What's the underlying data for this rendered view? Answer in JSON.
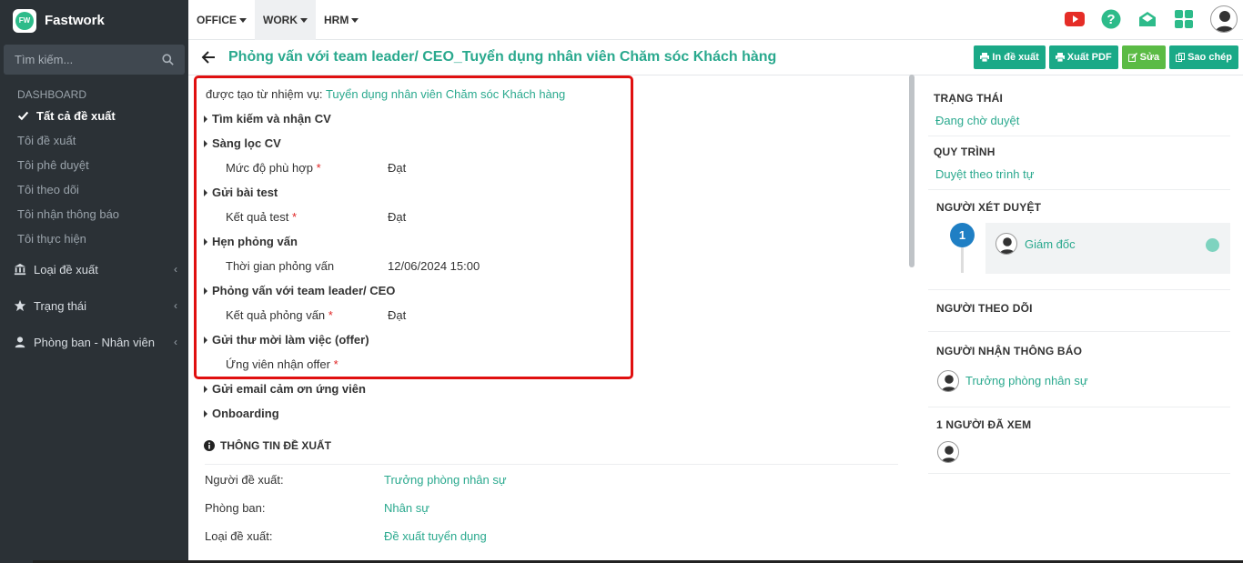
{
  "brand": {
    "name": "Fastwork",
    "logo_text": "FW"
  },
  "search": {
    "placeholder": "Tìm kiếm..."
  },
  "sidebar": {
    "section_title": "DASHBOARD",
    "items": [
      {
        "label": "Tất cả đề xuất",
        "active": true
      },
      {
        "label": "Tôi đề xuất"
      },
      {
        "label": "Tôi phê duyệt"
      },
      {
        "label": "Tôi theo dõi"
      },
      {
        "label": "Tôi nhận thông báo"
      },
      {
        "label": "Tôi thực hiện"
      }
    ],
    "groups": [
      {
        "label": "Loại đề xuất",
        "icon": "bank-icon"
      },
      {
        "label": "Trạng thái",
        "icon": "star-icon"
      },
      {
        "label": "Phòng ban - Nhân viên",
        "icon": "user-icon"
      }
    ]
  },
  "topmenu": [
    {
      "label": "OFFICE"
    },
    {
      "label": "WORK",
      "active": true
    },
    {
      "label": "HRM"
    }
  ],
  "header": {
    "title": "Phỏng vấn với team leader/ CEO_Tuyển dụng nhân viên Chăm sóc Khách hàng",
    "actions": {
      "print": "In đề xuất",
      "pdf": "Xuất PDF",
      "edit": "Sửa",
      "copy": "Sao chép"
    }
  },
  "main": {
    "created_prefix": "được tạo từ nhiệm vụ:",
    "created_link": "Tuyển dụng nhân viên Chăm sóc Khách hàng",
    "steps": {
      "s1": "Tìm kiếm và nhận CV",
      "s2": "Sàng lọc CV",
      "s3": "Gửi bài test",
      "s4": "Hẹn phỏng vấn",
      "s5": "Phỏng vấn với team leader/ CEO",
      "s6": "Gửi thư mời làm việc (offer)",
      "s7": "Gửi email cảm ơn ứng viên",
      "s8": "Onboarding"
    },
    "fields": {
      "f1_label": "Mức độ phù hợp",
      "f1_value": "Đạt",
      "f2_label": "Kết quả test",
      "f2_value": "Đạt",
      "f3_label": "Thời gian phỏng vấn",
      "f3_value": "12/06/2024 15:00",
      "f4_label": "Kết quả phỏng vấn",
      "f4_value": "Đạt",
      "f5_label": "Ứng viên nhận offer"
    },
    "info": {
      "title": "THÔNG TIN ĐỀ XUẤT",
      "rows": [
        {
          "label": "Người đề xuất:",
          "value": "Trưởng phòng nhân sự"
        },
        {
          "label": "Phòng ban:",
          "value": "Nhân sự"
        },
        {
          "label": "Loại đề xuất:",
          "value": "Đề xuất tuyển dụng"
        }
      ]
    }
  },
  "right": {
    "status_title": "TRẠNG THÁI",
    "status_value": "Đang chờ duyệt",
    "process_title": "QUY TRÌNH",
    "process_value": "Duyệt theo trình tự",
    "approvers_title": "NGƯỜI XÉT DUYỆT",
    "approver_step": "1",
    "approver_name": "Giám đốc",
    "followers_title": "NGƯỜI THEO DÕI",
    "notify_title": "NGƯỜI NHẬN THÔNG BÁO",
    "notify_name": "Trưởng phòng nhân sự",
    "viewed_title": "1 NGƯỜI ĐÃ XEM"
  },
  "colors": {
    "accent": "#2aa98e",
    "button": "#1aa987",
    "edit_button": "#5bbb45",
    "sidebar_bg": "#2b3136",
    "highlight": "#e01010",
    "step_badge": "#1f7fc4"
  }
}
